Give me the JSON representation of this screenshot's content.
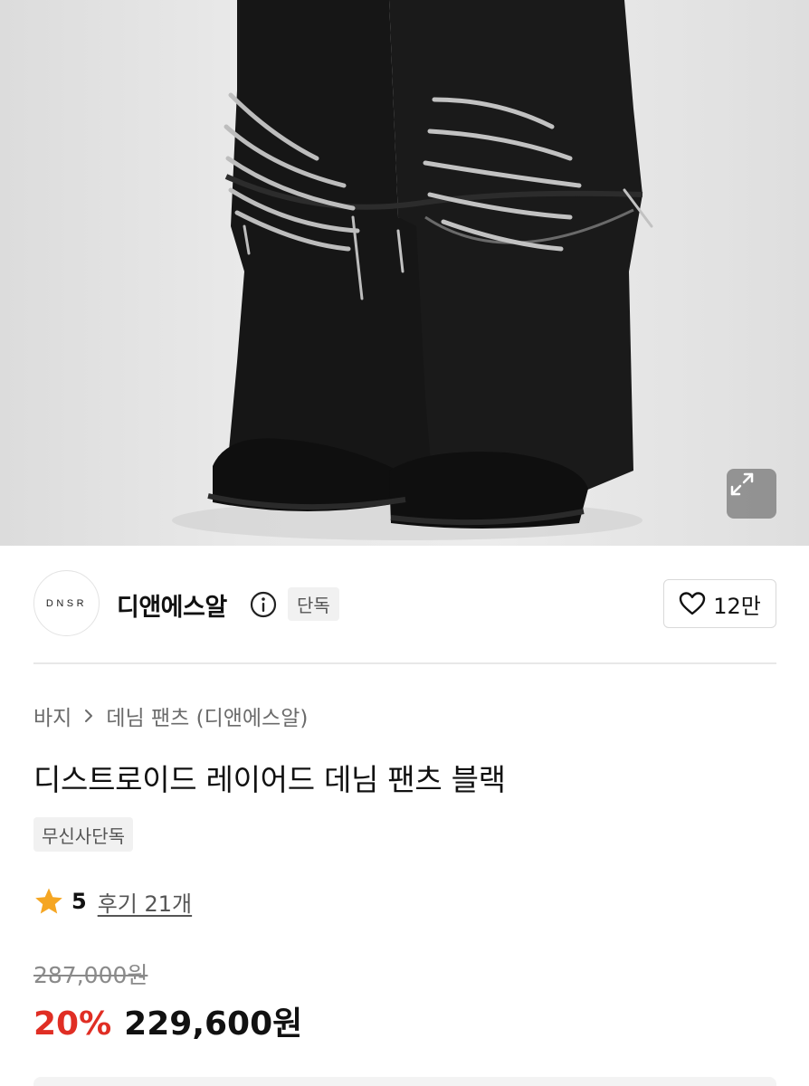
{
  "brand": {
    "logo_text": "DNSR",
    "name": "디앤에스알",
    "exclusive_label": "단독",
    "like_count": "12만"
  },
  "breadcrumb": {
    "category": "바지",
    "separator": ">",
    "subcategory": "데님 팬츠 (디앤에스알)"
  },
  "product": {
    "title": "디스트로이드 레이어드 데님 팬츠 블랙",
    "tag": "무신사단독"
  },
  "rating": {
    "score": "5",
    "reviews_label": "후기 21개"
  },
  "price": {
    "original": "287,000원",
    "discount": "20%",
    "final": "229,600원"
  },
  "colors": {
    "discount_red": "#e02e24",
    "star": "#f5a623",
    "chip_bg": "#f1f1f1"
  },
  "icons": [
    "expand-icon",
    "info-icon",
    "heart-icon",
    "star-icon",
    "chevron-right-icon"
  ]
}
